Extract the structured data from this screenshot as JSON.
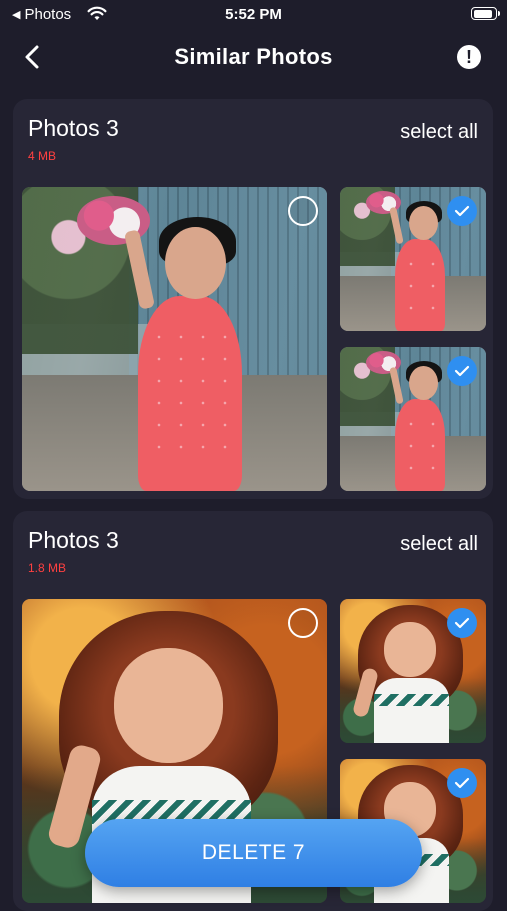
{
  "status_bar": {
    "back_app": "Photos",
    "time": "5:52 PM",
    "battery_level": 0.9
  },
  "nav": {
    "title": "Similar Photos",
    "back_icon": "chevron-left-icon",
    "info_icon": "exclamation-circle-icon",
    "info_glyph": "!"
  },
  "groups": [
    {
      "title": "Photos 3",
      "size": "4 MB",
      "select_all": "select all",
      "photos": [
        {
          "role": "main",
          "selected": false
        },
        {
          "role": "thumb",
          "selected": true
        },
        {
          "role": "thumb",
          "selected": true
        }
      ]
    },
    {
      "title": "Photos 3",
      "size": "1.8 MB",
      "select_all": "select all",
      "photos": [
        {
          "role": "main",
          "selected": false
        },
        {
          "role": "thumb",
          "selected": true
        },
        {
          "role": "thumb",
          "selected": true
        }
      ]
    }
  ],
  "delete_button": {
    "label": "DELETE 7"
  },
  "colors": {
    "background": "#1e1d2b",
    "card": "#272636",
    "accent": "#2f8ff0",
    "size_text": "#ff4040"
  }
}
